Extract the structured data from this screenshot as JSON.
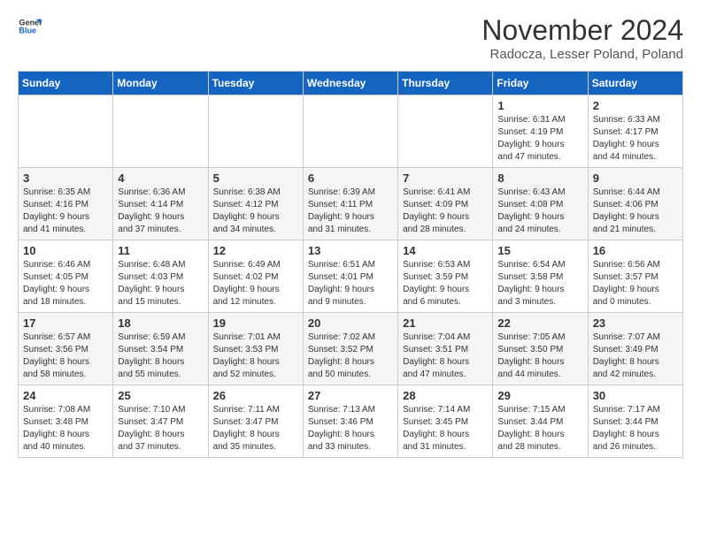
{
  "logo": {
    "line1": "General",
    "line2": "Blue"
  },
  "title": "November 2024",
  "location": "Radocza, Lesser Poland, Poland",
  "weekdays": [
    "Sunday",
    "Monday",
    "Tuesday",
    "Wednesday",
    "Thursday",
    "Friday",
    "Saturday"
  ],
  "weeks": [
    [
      {
        "day": "",
        "info": ""
      },
      {
        "day": "",
        "info": ""
      },
      {
        "day": "",
        "info": ""
      },
      {
        "day": "",
        "info": ""
      },
      {
        "day": "",
        "info": ""
      },
      {
        "day": "1",
        "info": "Sunrise: 6:31 AM\nSunset: 4:19 PM\nDaylight: 9 hours\nand 47 minutes."
      },
      {
        "day": "2",
        "info": "Sunrise: 6:33 AM\nSunset: 4:17 PM\nDaylight: 9 hours\nand 44 minutes."
      }
    ],
    [
      {
        "day": "3",
        "info": "Sunrise: 6:35 AM\nSunset: 4:16 PM\nDaylight: 9 hours\nand 41 minutes."
      },
      {
        "day": "4",
        "info": "Sunrise: 6:36 AM\nSunset: 4:14 PM\nDaylight: 9 hours\nand 37 minutes."
      },
      {
        "day": "5",
        "info": "Sunrise: 6:38 AM\nSunset: 4:12 PM\nDaylight: 9 hours\nand 34 minutes."
      },
      {
        "day": "6",
        "info": "Sunrise: 6:39 AM\nSunset: 4:11 PM\nDaylight: 9 hours\nand 31 minutes."
      },
      {
        "day": "7",
        "info": "Sunrise: 6:41 AM\nSunset: 4:09 PM\nDaylight: 9 hours\nand 28 minutes."
      },
      {
        "day": "8",
        "info": "Sunrise: 6:43 AM\nSunset: 4:08 PM\nDaylight: 9 hours\nand 24 minutes."
      },
      {
        "day": "9",
        "info": "Sunrise: 6:44 AM\nSunset: 4:06 PM\nDaylight: 9 hours\nand 21 minutes."
      }
    ],
    [
      {
        "day": "10",
        "info": "Sunrise: 6:46 AM\nSunset: 4:05 PM\nDaylight: 9 hours\nand 18 minutes."
      },
      {
        "day": "11",
        "info": "Sunrise: 6:48 AM\nSunset: 4:03 PM\nDaylight: 9 hours\nand 15 minutes."
      },
      {
        "day": "12",
        "info": "Sunrise: 6:49 AM\nSunset: 4:02 PM\nDaylight: 9 hours\nand 12 minutes."
      },
      {
        "day": "13",
        "info": "Sunrise: 6:51 AM\nSunset: 4:01 PM\nDaylight: 9 hours\nand 9 minutes."
      },
      {
        "day": "14",
        "info": "Sunrise: 6:53 AM\nSunset: 3:59 PM\nDaylight: 9 hours\nand 6 minutes."
      },
      {
        "day": "15",
        "info": "Sunrise: 6:54 AM\nSunset: 3:58 PM\nDaylight: 9 hours\nand 3 minutes."
      },
      {
        "day": "16",
        "info": "Sunrise: 6:56 AM\nSunset: 3:57 PM\nDaylight: 9 hours\nand 0 minutes."
      }
    ],
    [
      {
        "day": "17",
        "info": "Sunrise: 6:57 AM\nSunset: 3:56 PM\nDaylight: 8 hours\nand 58 minutes."
      },
      {
        "day": "18",
        "info": "Sunrise: 6:59 AM\nSunset: 3:54 PM\nDaylight: 8 hours\nand 55 minutes."
      },
      {
        "day": "19",
        "info": "Sunrise: 7:01 AM\nSunset: 3:53 PM\nDaylight: 8 hours\nand 52 minutes."
      },
      {
        "day": "20",
        "info": "Sunrise: 7:02 AM\nSunset: 3:52 PM\nDaylight: 8 hours\nand 50 minutes."
      },
      {
        "day": "21",
        "info": "Sunrise: 7:04 AM\nSunset: 3:51 PM\nDaylight: 8 hours\nand 47 minutes."
      },
      {
        "day": "22",
        "info": "Sunrise: 7:05 AM\nSunset: 3:50 PM\nDaylight: 8 hours\nand 44 minutes."
      },
      {
        "day": "23",
        "info": "Sunrise: 7:07 AM\nSunset: 3:49 PM\nDaylight: 8 hours\nand 42 minutes."
      }
    ],
    [
      {
        "day": "24",
        "info": "Sunrise: 7:08 AM\nSunset: 3:48 PM\nDaylight: 8 hours\nand 40 minutes."
      },
      {
        "day": "25",
        "info": "Sunrise: 7:10 AM\nSunset: 3:47 PM\nDaylight: 8 hours\nand 37 minutes."
      },
      {
        "day": "26",
        "info": "Sunrise: 7:11 AM\nSunset: 3:47 PM\nDaylight: 8 hours\nand 35 minutes."
      },
      {
        "day": "27",
        "info": "Sunrise: 7:13 AM\nSunset: 3:46 PM\nDaylight: 8 hours\nand 33 minutes."
      },
      {
        "day": "28",
        "info": "Sunrise: 7:14 AM\nSunset: 3:45 PM\nDaylight: 8 hours\nand 31 minutes."
      },
      {
        "day": "29",
        "info": "Sunrise: 7:15 AM\nSunset: 3:44 PM\nDaylight: 8 hours\nand 28 minutes."
      },
      {
        "day": "30",
        "info": "Sunrise: 7:17 AM\nSunset: 3:44 PM\nDaylight: 8 hours\nand 26 minutes."
      }
    ]
  ]
}
